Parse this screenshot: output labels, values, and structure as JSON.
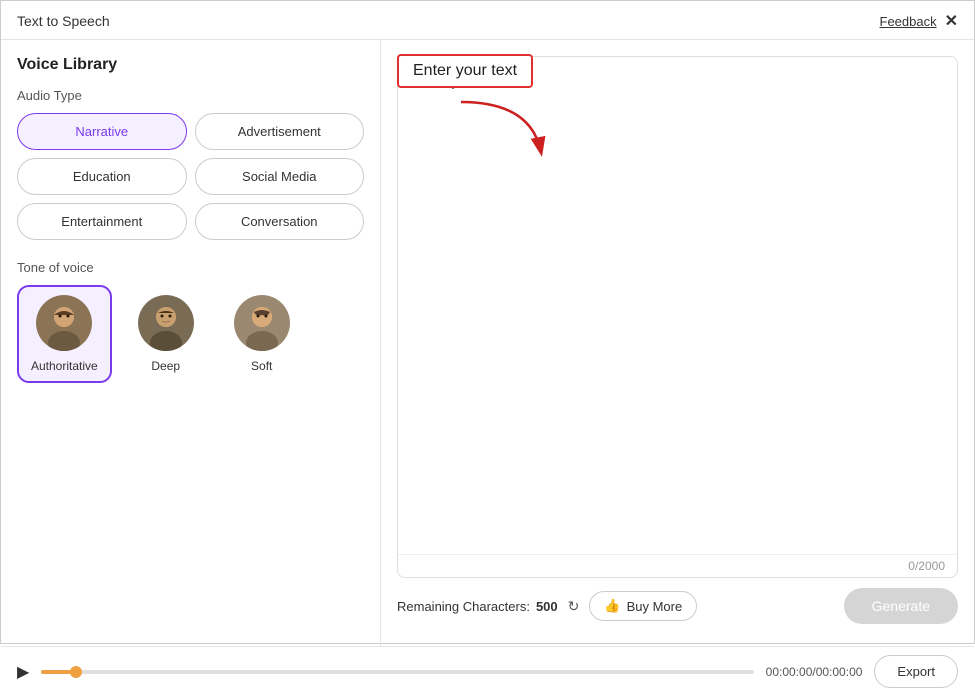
{
  "header": {
    "title": "Text to Speech",
    "feedback_label": "Feedback",
    "close_label": "✕"
  },
  "left_panel": {
    "voice_library_title": "Voice Library",
    "audio_type_title": "Audio Type",
    "audio_types": [
      {
        "id": "narrative",
        "label": "Narrative",
        "active": true
      },
      {
        "id": "advertisement",
        "label": "Advertisement",
        "active": false
      },
      {
        "id": "education",
        "label": "Education",
        "active": false
      },
      {
        "id": "social_media",
        "label": "Social Media",
        "active": false
      },
      {
        "id": "entertainment",
        "label": "Entertainment",
        "active": false
      },
      {
        "id": "conversation",
        "label": "Conversation",
        "active": false
      }
    ],
    "tone_title": "Tone of voice",
    "tones": [
      {
        "id": "authoritative",
        "label": "Authoritative",
        "active": true
      },
      {
        "id": "deep",
        "label": "Deep",
        "active": false
      },
      {
        "id": "soft",
        "label": "Soft",
        "active": false
      }
    ]
  },
  "right_panel": {
    "callout_label": "Enter your text",
    "textarea_placeholder": "Enter your text",
    "char_count": "0/2000",
    "remaining_label": "Remaining Characters:",
    "remaining_count": "500",
    "buy_more_label": "Buy More",
    "generate_label": "Generate"
  },
  "footer": {
    "time_display": "00:00:00/00:00:00",
    "export_label": "Export"
  }
}
